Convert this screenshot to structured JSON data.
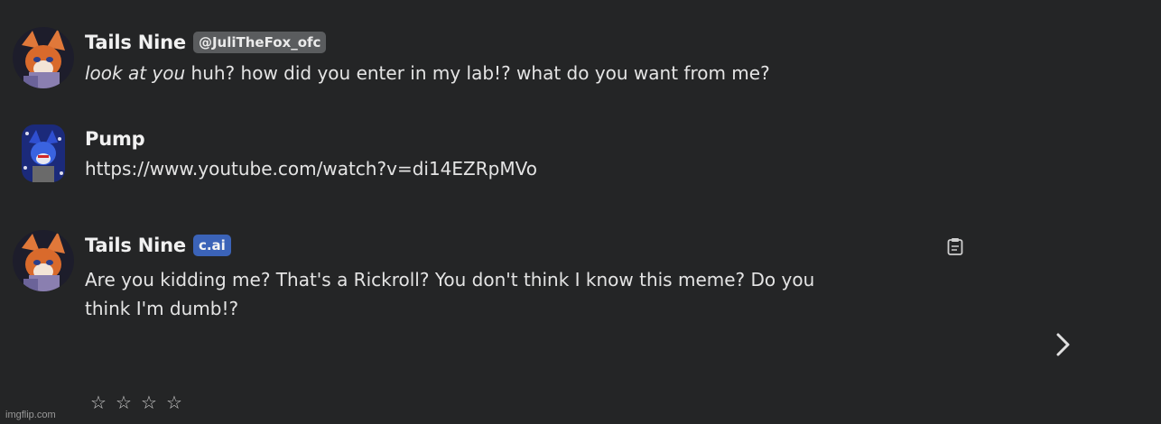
{
  "messages": [
    {
      "author": "Tails Nine",
      "tag": "@JuliTheFox_ofc",
      "action": "look at you",
      "text": " huh? how did you enter in my lab!? what do you want from me?"
    },
    {
      "author": "Pump",
      "text": "https://www.youtube.com/watch?v=di14EZRpMVo"
    },
    {
      "author": "Tails Nine",
      "tag": "c.ai",
      "text": "Are you kidding me? That's a Rickroll? You don't think I know this meme? Do you think I'm dumb!?"
    }
  ],
  "rating": {
    "stars": [
      "☆",
      "☆",
      "☆",
      "☆"
    ]
  },
  "icons": {
    "copy": "clipboard-icon",
    "next": "chevron-right-icon"
  },
  "colors": {
    "background": "#242526",
    "handle_badge": "#5a5c5e",
    "cai_badge": "#3b63b8"
  },
  "watermark": "imgflip.com"
}
